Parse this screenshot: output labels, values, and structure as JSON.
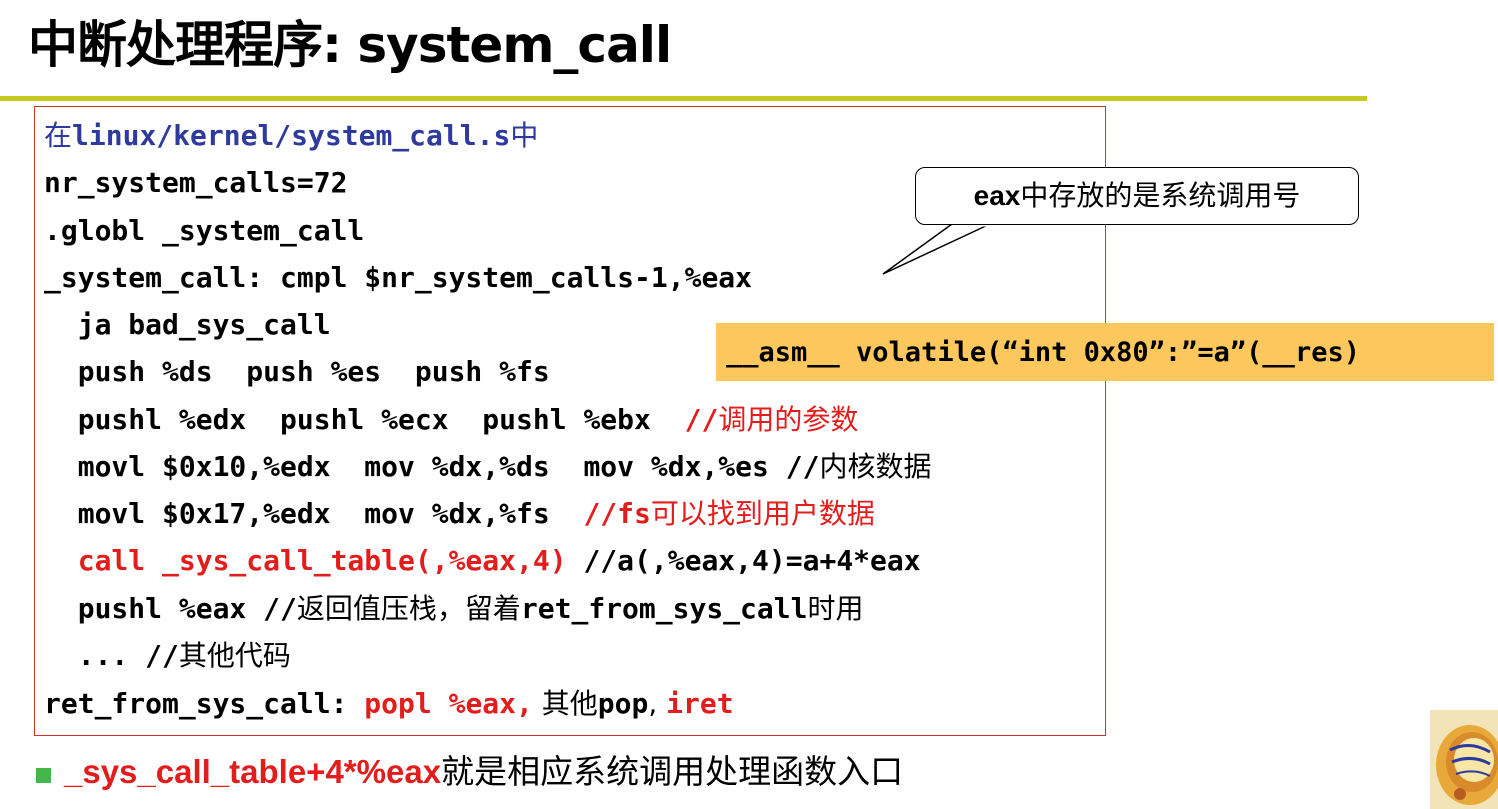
{
  "title": "中断处理程序: system_call",
  "code": {
    "line1_cjk_prefix": "在",
    "line1_path": "linux/kernel/system_call.s",
    "line1_cjk_suffix": "中",
    "line2": "nr_system_calls=72",
    "line3": ".globl _system_call",
    "line4": "_system_call: cmpl $nr_system_calls-1,%eax",
    "line5": "  ja bad_sys_call",
    "line6": "  push %ds  push %es  push %fs",
    "line7_code": "  pushl %edx  pushl %ecx  pushl %ebx  ",
    "line7_comment_slashes": "//",
    "line7_comment_text": "调用的参数",
    "line8_code": "  movl $0x10,%edx  mov %dx,%ds  mov %dx,%es //",
    "line8_comment_text": "内核数据",
    "line9_code": "  movl $0x17,%edx  mov %dx,%fs  ",
    "line9_comment_code": "//fs",
    "line9_comment_text": "可以找到用户数据",
    "line10_call": "  call _sys_call_table(,%eax,4)",
    "line10_comment": " //a(,%eax,4)=a+4*eax",
    "line11_code": "  pushl %eax //",
    "line11_cjk1": "返回值压栈，留着",
    "line11_code2": "ret_from_sys_call",
    "line11_cjk2": "时用",
    "line12_code": "  ... //",
    "line12_cjk": "其他代码",
    "line13_label": "ret_from_sys_call: ",
    "line13_popl": "popl %eax,",
    "line13_cjk": " 其他",
    "line13_pop": "pop",
    "line13_comma": ", ",
    "line13_iret": "iret"
  },
  "callout": {
    "bold": "eax",
    "text": "中存放的是系统调用号"
  },
  "asm_note": "__asm__ volatile(“int 0x80”:”=a”(__res)",
  "bullet": {
    "emph": "_sys_call_table+4*%eax",
    "text": "就是相应系统调用处理函数入口"
  },
  "colors": {
    "title_rule": "#c8c81e",
    "box_border": "#d4302d",
    "red": "#e31c1c",
    "blue": "#2e3a9e",
    "asm_bg": "#fcc85d",
    "bullet": "#44b64a"
  },
  "icons": {
    "corner_logo": "operating-systems-logo-icon"
  }
}
